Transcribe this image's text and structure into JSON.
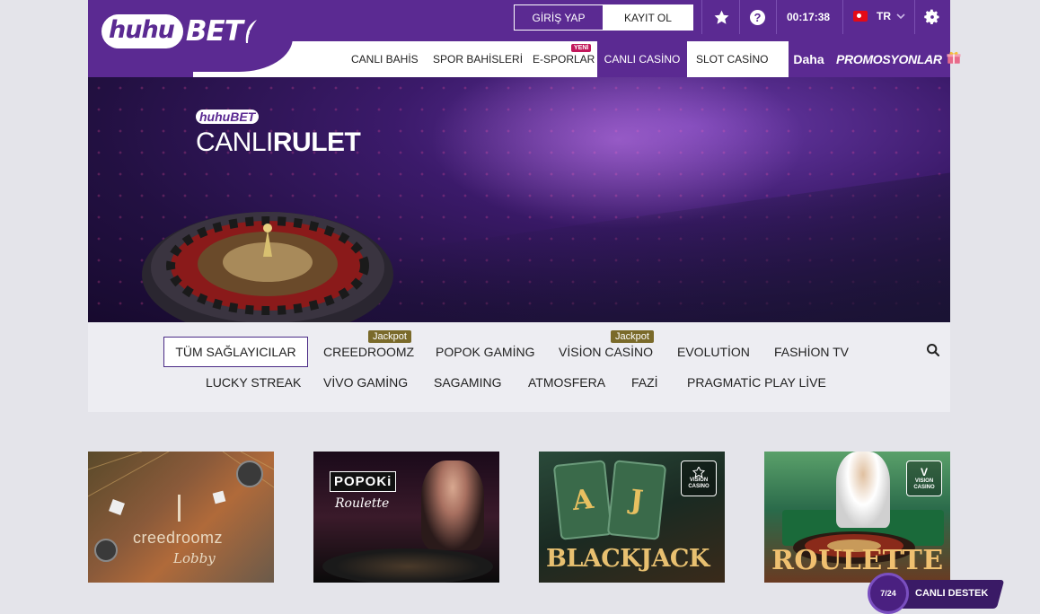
{
  "brand": {
    "logo_left": "huhu",
    "logo_right": "BET"
  },
  "header": {
    "login_label": "GİRİŞ YAP",
    "register_label": "KAYIT OL",
    "clock": "00:17:38",
    "language": "TR",
    "icons": [
      "star-icon",
      "help-icon",
      "chevron-down-icon",
      "gear-icon"
    ]
  },
  "nav": {
    "items": [
      {
        "label": "CANLI BAHİS"
      },
      {
        "label": "SPOR BAHİSLERİ"
      },
      {
        "label": "E-SPORLAR",
        "badge": "YENİ"
      },
      {
        "label": "CANLI CASİNO",
        "active": true
      },
      {
        "label": "SLOT CASİNO"
      }
    ],
    "more_label": "Daha",
    "promo_label": "PROMOSYONLAR"
  },
  "hero": {
    "brand": "huhuBET",
    "title_light": "CANLI",
    "title_bold": "RULET"
  },
  "providers": {
    "all_label": "TÜM SAĞLAYICILAR",
    "items": [
      {
        "label": "CREEDROOMZ",
        "badge": "Jackpot"
      },
      {
        "label": "POPOK GAMİNG"
      },
      {
        "label": "VİSİON CASİNO",
        "badge": "Jackpot"
      },
      {
        "label": "EVOLUTİON"
      },
      {
        "label": "FASHİON TV"
      },
      {
        "label": "LUCKY STREAK"
      },
      {
        "label": "VİVO GAMİNG"
      },
      {
        "label": "SAGAMING"
      },
      {
        "label": "ATMOSFERA"
      },
      {
        "label": "FAZİ"
      },
      {
        "label": "PRAGMATİC PLAY LİVE"
      }
    ]
  },
  "games": [
    {
      "title": "creedroomz",
      "subtitle": "Lobby"
    },
    {
      "title": "POPOKi",
      "subtitle": "Roulette"
    },
    {
      "title": "BLACKJACK",
      "cards": [
        "A",
        "J"
      ],
      "provider": "VISION CASINO"
    },
    {
      "title": "ROULETTE",
      "provider": "VISION CASINO"
    }
  ],
  "support": {
    "hours": "7/24",
    "label": "CANLI DESTEK"
  },
  "colors": {
    "brand_purple": "#5b2a92",
    "jackpot": "#7a6a2a",
    "new_badge": "#c2185b"
  }
}
